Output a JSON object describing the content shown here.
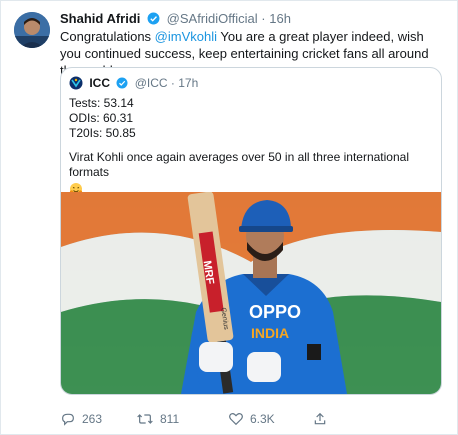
{
  "tweet": {
    "author_name": "Shahid Afridi",
    "handle": "@SAfridiOfficial",
    "separator": "·",
    "time": "16h",
    "text_prefix": "Congratulations ",
    "mention": "@imVkohli",
    "text_suffix": " You are a great player indeed, wish you continued success, keep entertaining cricket fans all around the world."
  },
  "quote": {
    "author_name": "ICC",
    "handle": "@ICC",
    "separator": "·",
    "time": "17h",
    "stats": [
      {
        "text": "Tests: 53.14"
      },
      {
        "text": "ODIs: 60.31"
      },
      {
        "text": "T20Is: 50.85"
      }
    ],
    "body": "Virat Kohli once again averages over 50 in all three international formats",
    "photo": {
      "bat_text": "MRF",
      "bat_sub": "Genius",
      "shirt_brand": "OPPO",
      "shirt_country": "INDIA"
    }
  },
  "actions": {
    "replies": "263",
    "retweets": "811",
    "likes": "6.3K"
  },
  "icons": {
    "verified": "verified-badge-icon",
    "reply": "reply-icon",
    "retweet": "retweet-icon",
    "like": "heart-icon",
    "share": "share-icon",
    "emoji": "hugging-face-emoji-icon"
  },
  "colors": {
    "accent": "#1da1f2",
    "link": "#1b95e0",
    "muted": "#657786",
    "border": "#ccd6dd"
  }
}
